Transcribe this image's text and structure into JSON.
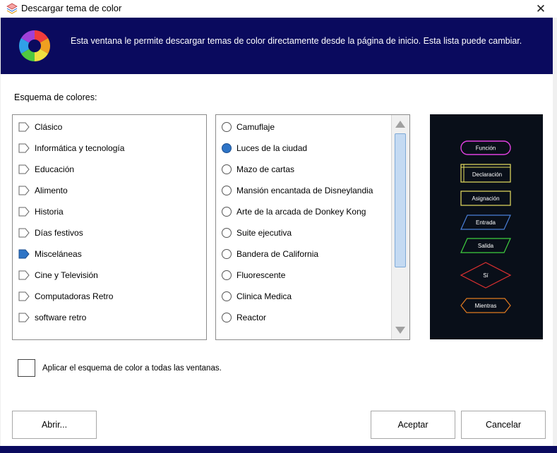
{
  "window": {
    "title": "Descargar tema de color",
    "close_icon": "close-icon",
    "app_icon": "layers-app-icon"
  },
  "banner": {
    "icon": "color-wheel-icon",
    "text": "Esta ventana le permite descargar temas de color directamente desde la página de inicio. Esta lista puede cambiar."
  },
  "scheme_label": "Esquema de colores:",
  "categories": [
    {
      "label": "Clásico",
      "selected": false
    },
    {
      "label": "Informática y tecnología",
      "selected": false
    },
    {
      "label": "Educación",
      "selected": false
    },
    {
      "label": "Alimento",
      "selected": false
    },
    {
      "label": "Historia",
      "selected": false
    },
    {
      "label": "Días festivos",
      "selected": false
    },
    {
      "label": "Misceláneas",
      "selected": true
    },
    {
      "label": "Cine y Televisión",
      "selected": false
    },
    {
      "label": "Computadoras Retro",
      "selected": false
    },
    {
      "label": "software retro",
      "selected": false
    }
  ],
  "themes": [
    {
      "label": "Camuflaje",
      "selected": false
    },
    {
      "label": "Luces de la ciudad",
      "selected": true
    },
    {
      "label": "Mazo de cartas",
      "selected": false
    },
    {
      "label": "Mansión encantada de Disneylandia",
      "selected": false
    },
    {
      "label": "Arte de la arcada de Donkey Kong",
      "selected": false
    },
    {
      "label": "Suite ejecutiva",
      "selected": false
    },
    {
      "label": "Bandera de California",
      "selected": false
    },
    {
      "label": "Fluorescente",
      "selected": false
    },
    {
      "label": "Clinica Medica",
      "selected": false
    },
    {
      "label": "Reactor",
      "selected": false
    }
  ],
  "preview": {
    "background": "#090f19",
    "shapes": [
      {
        "label": "Función",
        "kind": "terminator",
        "color": "#e040e0"
      },
      {
        "label": "Declaración",
        "kind": "process-double",
        "color": "#e8e060"
      },
      {
        "label": "Asignación",
        "kind": "process",
        "color": "#e8e060"
      },
      {
        "label": "Entrada",
        "kind": "parallelogram",
        "color": "#4a7fd8"
      },
      {
        "label": "Salida",
        "kind": "parallelogram",
        "color": "#3fcf3f"
      },
      {
        "label": "Sí",
        "kind": "decision",
        "color": "#e03030"
      },
      {
        "label": "Mientras",
        "kind": "loop",
        "color": "#e07a20"
      }
    ]
  },
  "apply_all": {
    "label": "Aplicar el esquema de color a todas las ventanas.",
    "checked": false
  },
  "buttons": {
    "open": "Abrir...",
    "accept": "Aceptar",
    "cancel": "Cancelar"
  },
  "colors": {
    "banner": "#0a0a5e",
    "selected_accent": "#2e74c6"
  }
}
